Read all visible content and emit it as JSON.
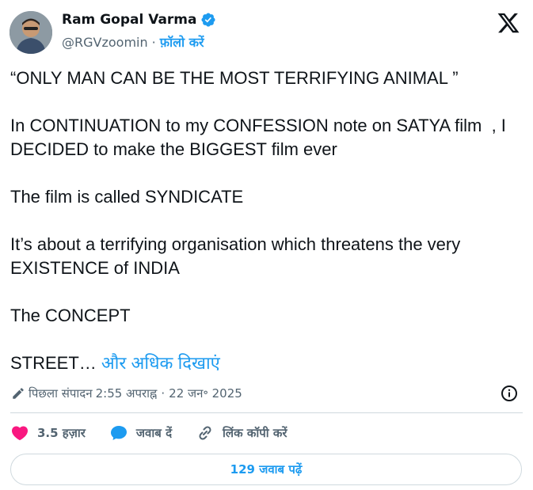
{
  "author": {
    "name": "Ram Gopal Varma",
    "handle": "@RGVzoomin",
    "separator": "·",
    "follow_label": "फ़ॉलो करें"
  },
  "tweet": {
    "text": "“ONLY MAN CAN BE THE MOST TERRIFYING ANIMAL ”\n\nIn CONTINUATION to my CONFESSION note on SATYA film  , I DECIDED to make the BIGGEST film ever\n\nThe film is called SYNDICATE\n\nIt’s about a terrifying organisation which threatens the very EXISTENCE of INDIA\n\nThe CONCEPT\n\nSTREET… ",
    "show_more": "और अधिक दिखाएं"
  },
  "meta": {
    "edited_label": "पिछला संपादन",
    "time": "2:55 अपराह्न",
    "separator": "·",
    "date": "22 जन॰ 2025"
  },
  "actions": {
    "likes": "3.5 हज़ार",
    "reply_label": "जवाब दें",
    "copy_link_label": "लिंक कॉपी करें"
  },
  "replies_button": "129 जवाब पढ़ें",
  "colors": {
    "accent": "#1d9bf0",
    "like": "#f91880",
    "text": "#0f1419",
    "muted": "#536471"
  },
  "icons": {
    "verified": "verified-badge-icon",
    "x_logo": "x-logo-icon",
    "pencil": "pencil-icon",
    "info": "info-icon",
    "like": "heart-icon",
    "reply": "reply-bubble-icon",
    "link": "link-icon"
  }
}
